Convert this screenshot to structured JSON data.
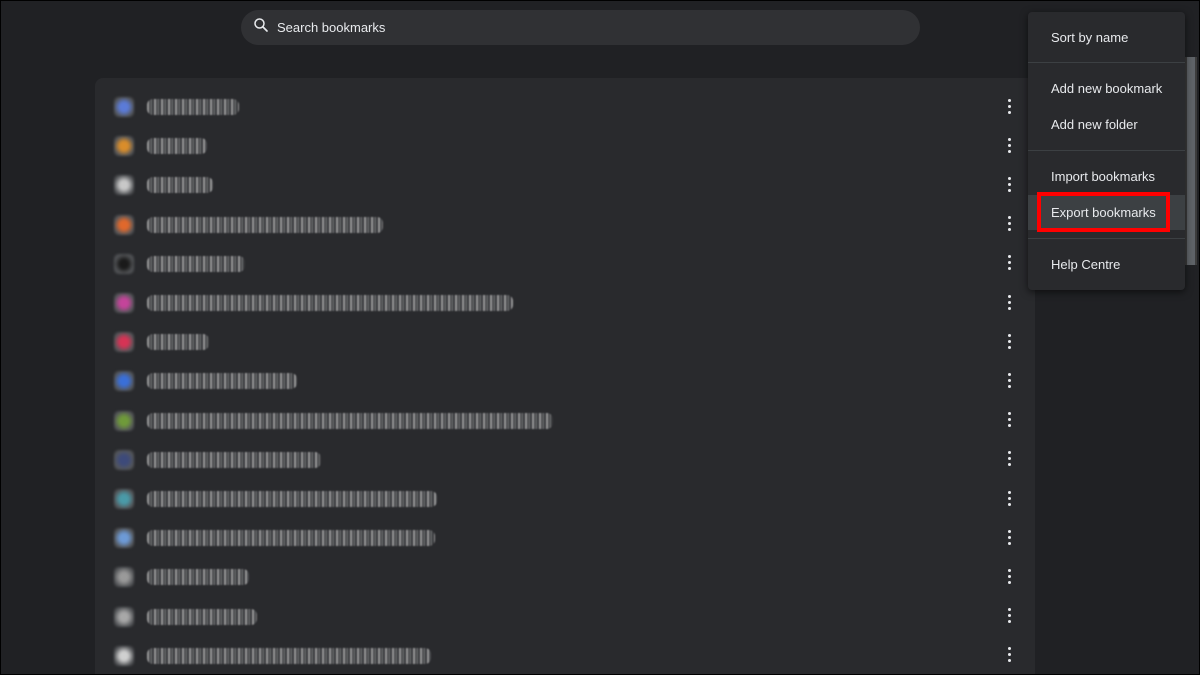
{
  "search": {
    "placeholder": "Search bookmarks",
    "icon": "search-icon"
  },
  "bookmarks": [
    {
      "favicon_color": "#5b7bd8"
    },
    {
      "favicon_color": "#d98d2b"
    },
    {
      "favicon_color": "#c8c8c8"
    },
    {
      "favicon_color": "#e0682c"
    },
    {
      "favicon_color": "#1a1a1a"
    },
    {
      "favicon_color": "#c4449a"
    },
    {
      "favicon_color": "#d63355"
    },
    {
      "favicon_color": "#3a6fd8"
    },
    {
      "favicon_color": "#6f9a3a"
    },
    {
      "favicon_color": "#3d4a7a"
    },
    {
      "favicon_color": "#4a9aa8"
    },
    {
      "favicon_color": "#6d9ad6"
    },
    {
      "favicon_color": "#9a9a9a"
    },
    {
      "favicon_color": "#a8a8a8"
    },
    {
      "favicon_color": "#d0d0d0"
    }
  ],
  "menu": {
    "sort_by_name": "Sort by name",
    "add_new_bookmark": "Add new bookmark",
    "add_new_folder": "Add new folder",
    "import_bookmarks": "Import bookmarks",
    "export_bookmarks": "Export bookmarks",
    "help_centre": "Help Centre"
  },
  "colors": {
    "background": "#202124",
    "card": "#292a2d",
    "menu": "#292a2d",
    "highlight": "#ff0000",
    "text": "#e8eaed"
  }
}
